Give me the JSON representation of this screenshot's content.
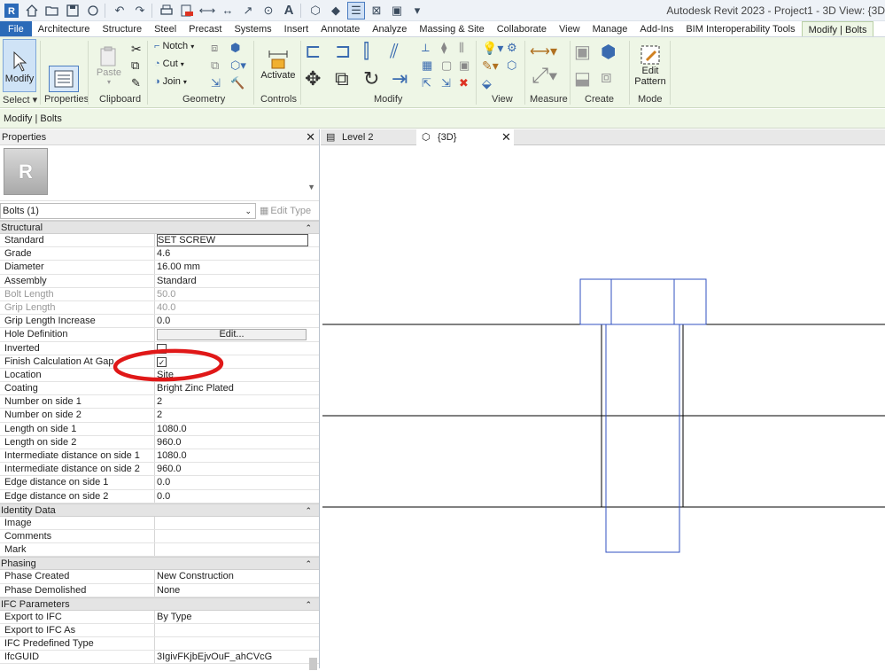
{
  "app": {
    "title": "Autodesk Revit 2023 - Project1 - 3D View: {3D"
  },
  "ribbon_tabs": [
    "File",
    "Architecture",
    "Structure",
    "Steel",
    "Precast",
    "Systems",
    "Insert",
    "Annotate",
    "Analyze",
    "Massing & Site",
    "Collaborate",
    "View",
    "Manage",
    "Add-Ins",
    "BIM Interoperability Tools",
    "Modify | Bolts"
  ],
  "ribbon": {
    "modify_label": "Modify",
    "select_label": "Select",
    "properties_label": "Properties",
    "paste_label": "Paste",
    "clipboard_label": "Clipboard",
    "notch_label": "Notch",
    "cut_label": "Cut",
    "join_label": "Join",
    "geometry_label": "Geometry",
    "activate_label": "Activate",
    "controls_label": "Controls",
    "modify_panel_label": "Modify",
    "view_label": "View",
    "measure_label": "Measure",
    "create_label": "Create",
    "edit_pattern_line1": "Edit",
    "edit_pattern_line2": "Pattern",
    "mode_label": "Mode"
  },
  "context_bar": {
    "text": "Modify | Bolts"
  },
  "properties": {
    "header": "Properties",
    "type_logo": "R",
    "filter": "Bolts (1)",
    "edit_type": "Edit Type",
    "groups": [
      {
        "name": "Structural",
        "rows": [
          {
            "k": "Standard",
            "v": "SET SCREW",
            "kind": "input"
          },
          {
            "k": "Grade",
            "v": "4.6"
          },
          {
            "k": "Diameter",
            "v": "16.00 mm"
          },
          {
            "k": "Assembly",
            "v": "Standard"
          },
          {
            "k": "Bolt Length",
            "v": "50.0",
            "dis": true
          },
          {
            "k": "Grip Length",
            "v": "40.0",
            "dis": true
          },
          {
            "k": "Grip Length Increase",
            "v": "0.0"
          },
          {
            "k": "Hole Definition",
            "v": "Edit...",
            "kind": "button"
          },
          {
            "k": "Inverted",
            "v": "",
            "kind": "check",
            "checked": false
          },
          {
            "k": "Finish Calculation At Gap",
            "v": "",
            "kind": "check",
            "checked": true
          },
          {
            "k": "Location",
            "v": "Site"
          },
          {
            "k": "Coating",
            "v": "Bright Zinc Plated"
          },
          {
            "k": "Number on side 1",
            "v": "2"
          },
          {
            "k": "Number on side 2",
            "v": "2"
          },
          {
            "k": "Length on side 1",
            "v": "1080.0"
          },
          {
            "k": "Length on side 2",
            "v": "960.0"
          },
          {
            "k": "Intermediate distance on side 1",
            "v": "1080.0"
          },
          {
            "k": "Intermediate distance on side 2",
            "v": "960.0"
          },
          {
            "k": "Edge distance on side 1",
            "v": "0.0"
          },
          {
            "k": "Edge distance on side 2",
            "v": "0.0"
          }
        ]
      },
      {
        "name": "Identity Data",
        "rows": [
          {
            "k": "Image",
            "v": ""
          },
          {
            "k": "Comments",
            "v": ""
          },
          {
            "k": "Mark",
            "v": ""
          }
        ]
      },
      {
        "name": "Phasing",
        "rows": [
          {
            "k": "Phase Created",
            "v": "New Construction"
          },
          {
            "k": "Phase Demolished",
            "v": "None"
          }
        ]
      },
      {
        "name": "IFC Parameters",
        "rows": [
          {
            "k": "Export to IFC",
            "v": "By Type"
          },
          {
            "k": "Export to IFC As",
            "v": ""
          },
          {
            "k": "IFC Predefined Type",
            "v": ""
          },
          {
            "k": "IfcGUID",
            "v": "3IgivFKjbEjvOuF_ahCVcG"
          }
        ]
      }
    ]
  },
  "view_tabs": [
    {
      "label": "Level 2",
      "active": false
    },
    {
      "label": "{3D}",
      "active": true
    }
  ],
  "colors": {
    "accent": "#2b6ab8",
    "ribbon_bg": "#eef6e6",
    "annotation": "#e01818",
    "bolt_lines": "#3050c0"
  }
}
